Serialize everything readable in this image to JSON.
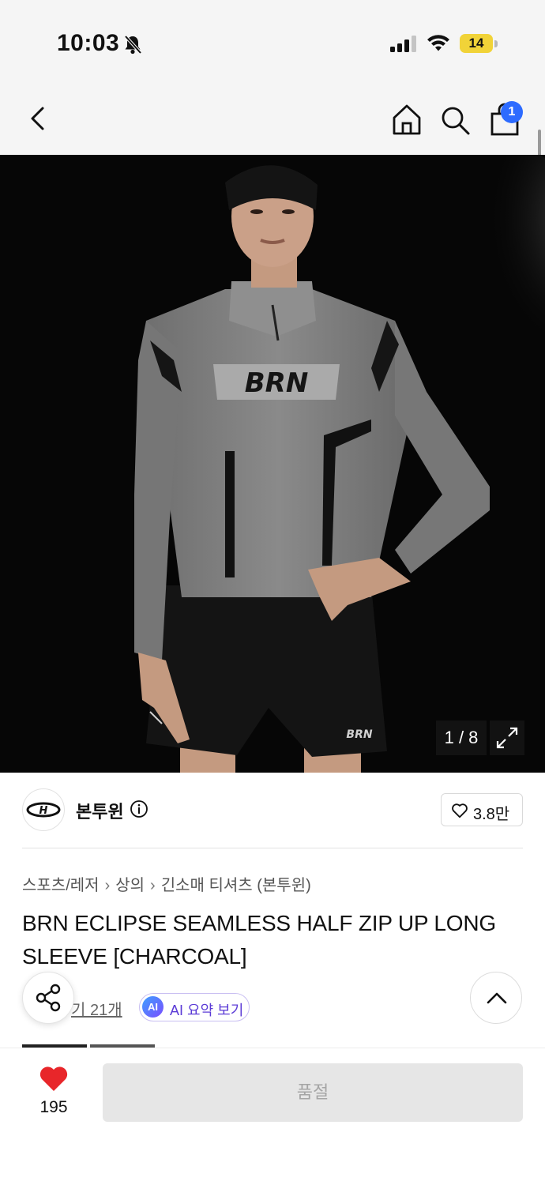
{
  "status_bar": {
    "time": "10:03",
    "battery": "14",
    "icons": [
      "bell-slash-icon",
      "cellular-signal-icon",
      "wifi-icon",
      "battery-icon"
    ]
  },
  "nav": {
    "icons": [
      "back-icon",
      "home-icon",
      "search-icon",
      "shopping-bag-icon"
    ],
    "cart_badge": "1"
  },
  "gallery": {
    "counter": "1 / 8",
    "shirt_logo": "BRN",
    "shorts_logo": "BRN"
  },
  "brand": {
    "name": "본투윈",
    "likes": "3.8만",
    "logo_text": "H"
  },
  "product": {
    "breadcrumb": [
      "스포츠/레저",
      "상의",
      "긴소매 티셔츠 (본투윈)"
    ],
    "title": "BRN ECLIPSE SEAMLESS HALF ZIP UP LONG SLEEVE [CHARCOAL]",
    "review_text": "기 21개",
    "ai_badge": "AI",
    "ai_summary_label": "AI 요약 보기"
  },
  "bottom": {
    "wish_count": "195",
    "soldout_label": "품절"
  },
  "colors": {
    "badge_blue": "#2d6bff",
    "heart_red": "#e8262a",
    "ai_purple": "#5b3bd6",
    "disabled_gray": "#e6e6e6"
  }
}
